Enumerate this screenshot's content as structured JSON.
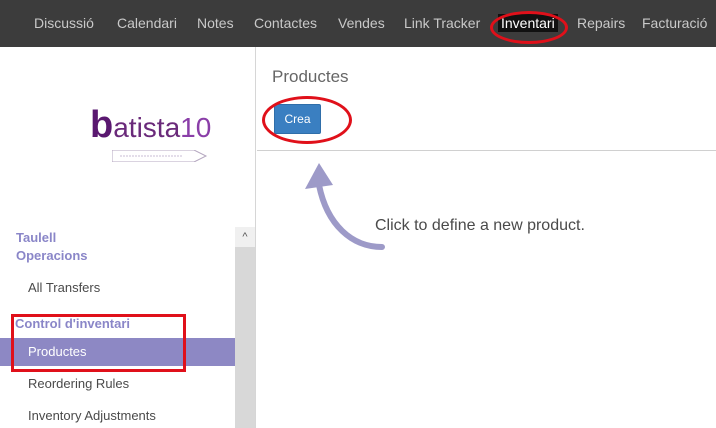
{
  "topbar": {
    "items": [
      {
        "label": "Discussió"
      },
      {
        "label": "Calendari"
      },
      {
        "label": "Notes"
      },
      {
        "label": "Contactes"
      },
      {
        "label": "Vendes"
      },
      {
        "label": "Link Tracker"
      },
      {
        "label": "Inventari",
        "active": true
      },
      {
        "label": "Repairs"
      },
      {
        "label": "Facturació"
      }
    ]
  },
  "sidebar": {
    "logo_text": {
      "b": "b",
      "atista": "atista",
      "num": "10"
    },
    "section_taulell": "Taulell",
    "section_operacions": "Operacions",
    "item_all_transfers": "All Transfers",
    "section_control": "Control d'inventari",
    "item_productes": "Productes",
    "item_reordering": "Reordering Rules",
    "item_adjustments": "Inventory Adjustments"
  },
  "main": {
    "title": "Productes",
    "create_label": "Crea",
    "hint": "Click to define a new product."
  },
  "colors": {
    "topbar_bg": "#3c3c3c",
    "accent_button": "#3a7fc1",
    "sidebar_active": "#8d88c4",
    "annotation_red": "#e0101a"
  }
}
